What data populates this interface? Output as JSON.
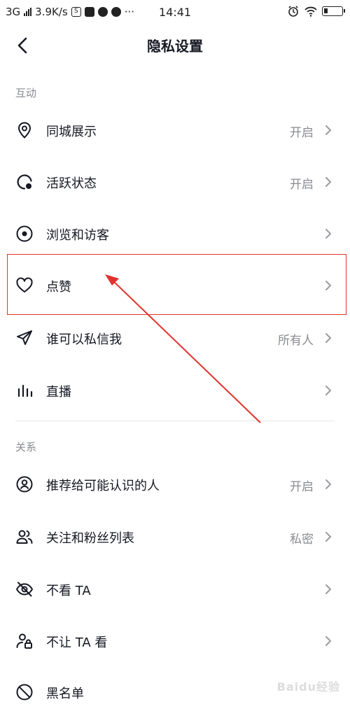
{
  "status_bar": {
    "network": "3G",
    "speed": "3.9K/s",
    "time": "14:41",
    "icons": [
      "signal-icon",
      "s-app-icon",
      "mail-icon",
      "browser-icon",
      "app-icon",
      "more-icon",
      "alarm-icon",
      "wifi-icon",
      "battery-icon"
    ]
  },
  "nav": {
    "title": "隐私设置",
    "back_icon": "chevron-left-icon"
  },
  "sections": [
    {
      "title": "互动",
      "items": [
        {
          "label": "同城展示",
          "value": "开启",
          "icon": "location-pin-icon"
        },
        {
          "label": "活跃状态",
          "value": "开启",
          "icon": "activity-status-icon"
        },
        {
          "label": "浏览和访客",
          "value": "",
          "icon": "eye-icon"
        },
        {
          "label": "点赞",
          "value": "",
          "icon": "heart-icon"
        },
        {
          "label": "谁可以私信我",
          "value": "所有人",
          "icon": "send-icon"
        },
        {
          "label": "直播",
          "value": "",
          "icon": "live-bars-icon"
        }
      ]
    },
    {
      "title": "关系",
      "items": [
        {
          "label": "推荐给可能认识的人",
          "value": "开启",
          "icon": "person-circle-icon"
        },
        {
          "label": "关注和粉丝列表",
          "value": "私密",
          "icon": "people-icon"
        },
        {
          "label": "不看 TA",
          "value": "",
          "icon": "eye-off-icon"
        },
        {
          "label": "不让 TA 看",
          "value": "",
          "icon": "person-lock-icon"
        },
        {
          "label": "黑名单",
          "value": "",
          "icon": "block-icon"
        }
      ]
    }
  ],
  "annotation": {
    "highlight_color": "#e0332c",
    "target": "点赞"
  },
  "watermark": "Baidu经验"
}
